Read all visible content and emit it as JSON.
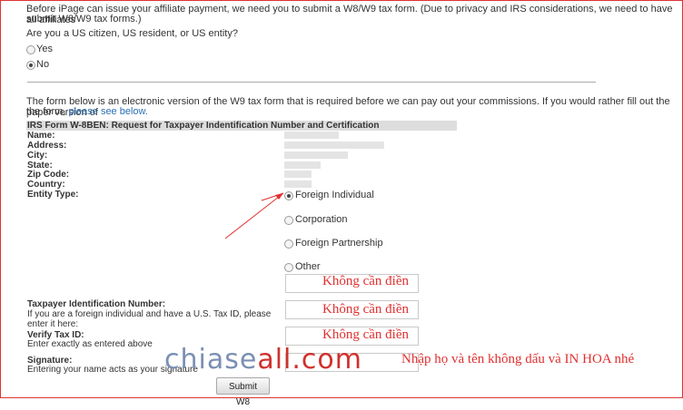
{
  "intro": {
    "line1": "Before iPage can issue your affiliate payment, we need you to submit a W8/W9 tax form. (Due to privacy and IRS considerations, we need to have all affiliates",
    "line2": "submit W8/W9 tax forms.)"
  },
  "question": "Are you a US citizen, US resident, or US entity?",
  "us_options": [
    {
      "label": "Yes",
      "checked": false
    },
    {
      "label": "No",
      "checked": true
    }
  ],
  "form_note": {
    "line1": "The form below is an electronic version of the W9 tax form that is required before we can pay out your commissions. If you would rather fill out the paper version of",
    "line2_prefix": "the form, ",
    "link": "please see below."
  },
  "form_title": "IRS Form W-8BEN: Request for Taxpayer Indentification Number and Certification",
  "fields": {
    "name": "Name:",
    "address": "Address:",
    "city": "City:",
    "state": "State:",
    "zip": "Zip Code:",
    "country": "Country:",
    "entity_type": "Entity Type:"
  },
  "entity_options": [
    {
      "label": "Foreign Individual",
      "checked": true
    },
    {
      "label": "Corporation",
      "checked": false
    },
    {
      "label": "Foreign Partnership",
      "checked": false
    },
    {
      "label": "Other",
      "checked": false
    }
  ],
  "tin": {
    "label": "Taxpayer Identification Number:",
    "help": "If you are a foreign individual and have a U.S. Tax ID, please enter it here:"
  },
  "verify": {
    "label": "Verify Tax ID:",
    "help": "Enter exactly as entered above"
  },
  "signature": {
    "label": "Signature:",
    "help": "Entering your name acts as your signature"
  },
  "submit_label": "Submit W8",
  "annotations": {
    "note1": "Không cần điền",
    "note2": "Không cần điền",
    "note3": "Không cần điền",
    "note4": "Nhập họ và tên không dấu và IN HOA nhé"
  },
  "watermark": {
    "part1": "chiase",
    "part2": "all.com"
  },
  "colors": {
    "annotation": "#e03030",
    "link": "#2a6fb5",
    "border": "#d33"
  }
}
